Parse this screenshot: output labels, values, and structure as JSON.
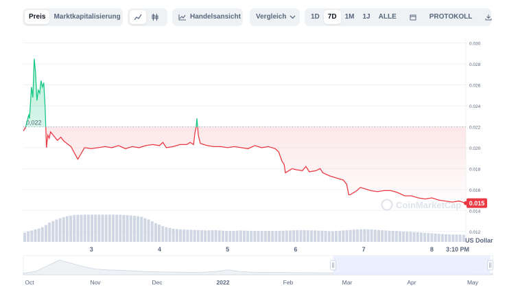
{
  "toolbar": {
    "price_tab": "Preis",
    "marketcap_tab": "Marktkapitalisierung",
    "line_icon": "line-chart-icon",
    "candle_icon": "candlestick-icon",
    "trading_view_label": "Handelsansicht",
    "compare_label": "Vergleich",
    "ranges": [
      "1D",
      "7D",
      "1M",
      "1J",
      "ALLE"
    ],
    "active_range": "7D",
    "calendar_icon": "calendar-icon",
    "log_label": "PROTOKOLL",
    "download_icon": "download-icon"
  },
  "colors": {
    "down": "#ea3943",
    "up": "#16c784",
    "volume": "#cfd6e4",
    "nav_fill": "#e6edfd"
  },
  "chart_data": {
    "type": "line",
    "title": "",
    "ylabel": "",
    "y_unit_label": "US Dollar",
    "ylim": [
      0.011,
      0.0305
    ],
    "y_ticks": [
      "0.030",
      "0.028",
      "0.026",
      "0.024",
      "0.022",
      "0.020",
      "0.018",
      "0.016",
      "0.014",
      "0.012"
    ],
    "x_ticks": [
      "3",
      "4",
      "5",
      "6",
      "7",
      "8",
      "3:10 PM"
    ],
    "x_range": [
      2.0,
      8.5
    ],
    "reference_value": 0.022,
    "reference_label": "0,022",
    "current_value_label": "0.015",
    "watermark": "CoinMarketCap",
    "grid": true,
    "series": [
      {
        "x": [
          2.0,
          2.03,
          2.06,
          2.07,
          2.08,
          2.09,
          2.1,
          2.12,
          2.14,
          2.16,
          2.18,
          2.2,
          2.22,
          2.24,
          2.26,
          2.28,
          2.3,
          2.32,
          2.34,
          2.36,
          2.38,
          2.4,
          2.45,
          2.5,
          2.55,
          2.6,
          2.7,
          2.8,
          2.9,
          3.0,
          3.1,
          3.2,
          3.3,
          3.4,
          3.5,
          3.6,
          3.7,
          3.8,
          3.9,
          4.0,
          4.05,
          4.1,
          4.2,
          4.3,
          4.4,
          4.45,
          4.5,
          4.52,
          4.54,
          4.55,
          4.57,
          4.6,
          4.7,
          4.8,
          4.9,
          5.0,
          5.1,
          5.2,
          5.3,
          5.4,
          5.5,
          5.6,
          5.7,
          5.75,
          5.8,
          5.83,
          5.85,
          5.9,
          5.95,
          6.0,
          6.1,
          6.15,
          6.2,
          6.3,
          6.36,
          6.4,
          6.5,
          6.6,
          6.7,
          6.75,
          6.78,
          6.8,
          6.85,
          6.9,
          6.95,
          7.0,
          7.1,
          7.2,
          7.3,
          7.4,
          7.5,
          7.6,
          7.7,
          7.8,
          7.9,
          8.0,
          8.1,
          8.2,
          8.3,
          8.4,
          8.5
        ],
        "y": [
          0.0216,
          0.0219,
          0.0226,
          0.0229,
          0.0231,
          0.0228,
          0.0237,
          0.0258,
          0.0248,
          0.0285,
          0.0271,
          0.0245,
          0.0255,
          0.0252,
          0.0264,
          0.0258,
          0.0262,
          0.0238,
          0.02,
          0.0212,
          0.0209,
          0.0215,
          0.0211,
          0.0207,
          0.021,
          0.0206,
          0.0201,
          0.0189,
          0.02,
          0.0199,
          0.02,
          0.0201,
          0.02,
          0.0202,
          0.0199,
          0.0201,
          0.02,
          0.0202,
          0.0203,
          0.0202,
          0.0205,
          0.02,
          0.0201,
          0.0203,
          0.0203,
          0.0205,
          0.0203,
          0.0214,
          0.022,
          0.0228,
          0.0212,
          0.0204,
          0.0202,
          0.0201,
          0.0201,
          0.02,
          0.0201,
          0.02,
          0.0199,
          0.0202,
          0.02,
          0.0201,
          0.0199,
          0.0196,
          0.0187,
          0.0184,
          0.0176,
          0.0178,
          0.018,
          0.0179,
          0.0178,
          0.0182,
          0.0177,
          0.0178,
          0.018,
          0.0176,
          0.0173,
          0.0171,
          0.0169,
          0.0165,
          0.0155,
          0.0155,
          0.0157,
          0.0159,
          0.0162,
          0.0161,
          0.0159,
          0.0158,
          0.0159,
          0.0159,
          0.0157,
          0.0154,
          0.0154,
          0.0152,
          0.0151,
          0.0152,
          0.015,
          0.0149,
          0.0148,
          0.0149,
          0.0147
        ]
      }
    ],
    "volume": [
      0.3,
      0.38,
      0.45,
      0.62,
      0.74,
      0.82,
      0.87,
      0.88,
      0.88,
      0.88,
      0.88,
      0.88,
      0.87,
      0.85,
      0.82,
      0.72,
      0.58,
      0.48,
      0.42,
      0.4,
      0.39,
      0.38,
      0.37,
      0.38,
      0.36,
      0.35,
      0.37,
      0.36,
      0.35,
      0.36,
      0.35,
      0.36,
      0.37,
      0.38,
      0.38,
      0.37,
      0.36,
      0.34,
      0.36,
      0.38,
      0.4,
      0.41,
      0.4,
      0.38,
      0.36,
      0.35,
      0.33,
      0.32,
      0.3,
      0.28,
      0.26,
      0.24,
      0.24,
      0.23
    ]
  },
  "navigator": {
    "x_labels": [
      "Oct",
      "Nov",
      "Dec",
      "2022",
      "Feb",
      "Mar",
      "Apr",
      "May"
    ],
    "history": [
      0.1,
      0.2,
      0.55,
      0.9,
      0.7,
      0.5,
      0.35,
      0.3,
      0.28,
      0.24,
      0.2,
      0.18,
      0.17,
      0.16,
      0.15,
      0.16,
      0.2,
      0.3,
      0.2,
      0.16,
      0.15,
      0.14,
      0.14,
      0.13,
      0.13,
      0.12,
      0.12,
      0.12,
      0.11,
      0.11,
      0.1,
      0.1,
      0.1,
      0.1,
      0.09,
      0.09,
      0.09,
      0.09,
      0.08,
      0.08
    ],
    "selection": [
      0.66,
      0.995
    ]
  }
}
